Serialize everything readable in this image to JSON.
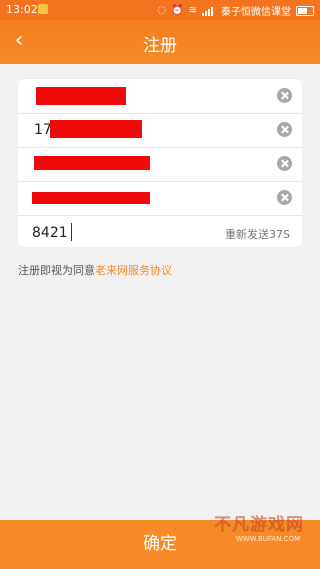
{
  "status_bar": {
    "time": "13:02",
    "carrier": "秦子恒微信课堂",
    "icons": [
      "app-notification-icon",
      "mute-icon",
      "alarm-icon",
      "wifi-icon",
      "signal-icon",
      "battery-icon"
    ]
  },
  "header": {
    "title": "注册",
    "back_icon": "chevron-left-icon"
  },
  "form": {
    "phone_prefix": "17",
    "verification_code": "8421",
    "resend_label": "重新发送37S",
    "clear_icon": "clear-circle-icon",
    "redacted_color": "#ef0b0b"
  },
  "agreement": {
    "prefix": "注册即视为同意",
    "link": "老来网服务协议"
  },
  "confirm_button": "确定",
  "watermark": {
    "title": "不凡游戏网",
    "url": "WWW.BUFAN.COM"
  },
  "colors": {
    "accent": "#f58a27",
    "background": "#f1f1f1"
  }
}
